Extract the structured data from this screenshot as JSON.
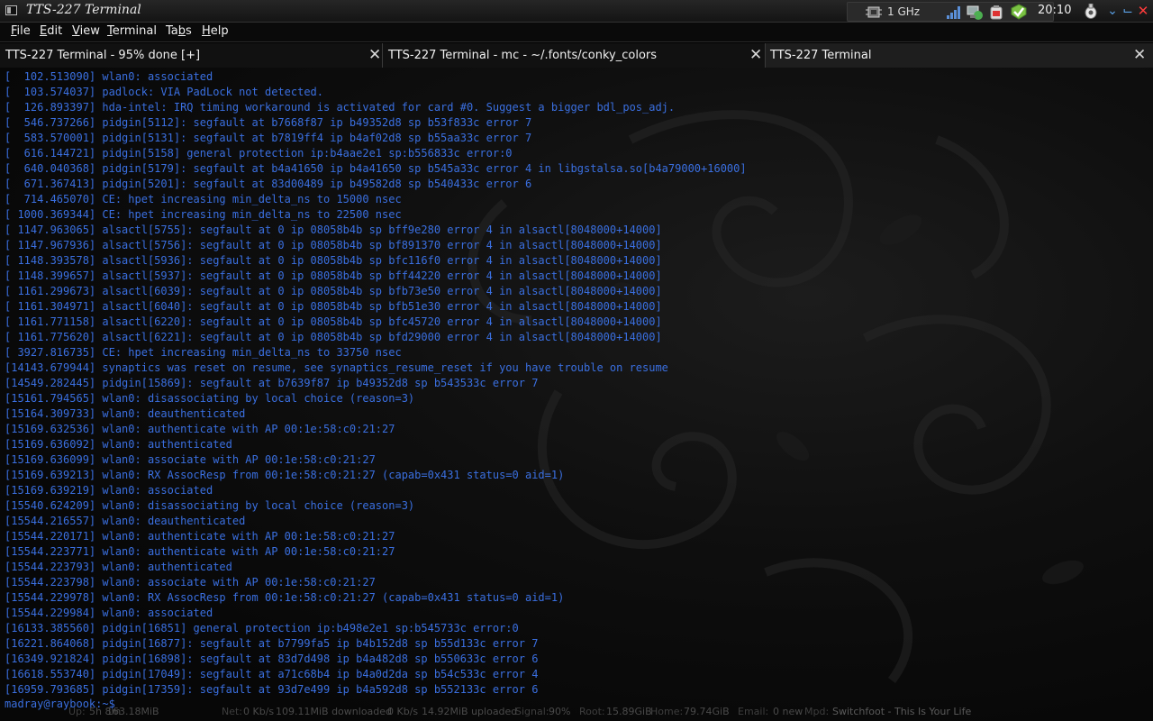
{
  "window": {
    "title": "TTS-227 Terminal",
    "clock": "20:10",
    "tray": {
      "cpu_freq": "1 GHz",
      "icons": [
        "cpu-icon",
        "signal-strength-icon",
        "network-icon",
        "battery-icon",
        "update-check-icon",
        "power-icon"
      ]
    },
    "controls": [
      "minimize",
      "maximize",
      "close"
    ]
  },
  "menu": {
    "file": "File",
    "edit": "Edit",
    "view": "View",
    "terminal": "Terminal",
    "tabs": "Tabs",
    "help": "Help"
  },
  "tabs": [
    {
      "label": "TTS-227 Terminal - 95% done [+]"
    },
    {
      "label": "TTS-227 Terminal - mc - ~/.fonts/conky_colors"
    },
    {
      "label": "TTS-227 Terminal"
    }
  ],
  "terminal": {
    "lines": [
      "[  102.513090] wlan0: associated",
      "[  103.574037] padlock: VIA PadLock not detected.",
      "[  126.893397] hda-intel: IRQ timing workaround is activated for card #0. Suggest a bigger bdl_pos_adj.",
      "[  546.737266] pidgin[5112]: segfault at b7668f87 ip b49352d8 sp b53f833c error 7",
      "[  583.570001] pidgin[5131]: segfault at b7819ff4 ip b4af02d8 sp b55aa33c error 7",
      "[  616.144721] pidgin[5158] general protection ip:b4aae2e1 sp:b556833c error:0",
      "[  640.040368] pidgin[5179]: segfault at b4a41650 ip b4a41650 sp b545a33c error 4 in libgstalsa.so[b4a79000+16000]",
      "[  671.367413] pidgin[5201]: segfault at 83d00489 ip b49582d8 sp b540433c error 6",
      "[  714.465070] CE: hpet increasing min_delta_ns to 15000 nsec",
      "[ 1000.369344] CE: hpet increasing min_delta_ns to 22500 nsec",
      "[ 1147.963065] alsactl[5755]: segfault at 0 ip 08058b4b sp bff9e280 error 4 in alsactl[8048000+14000]",
      "[ 1147.967936] alsactl[5756]: segfault at 0 ip 08058b4b sp bf891370 error 4 in alsactl[8048000+14000]",
      "[ 1148.393578] alsactl[5936]: segfault at 0 ip 08058b4b sp bfc116f0 error 4 in alsactl[8048000+14000]",
      "[ 1148.399657] alsactl[5937]: segfault at 0 ip 08058b4b sp bff44220 error 4 in alsactl[8048000+14000]",
      "[ 1161.299673] alsactl[6039]: segfault at 0 ip 08058b4b sp bfb73e50 error 4 in alsactl[8048000+14000]",
      "[ 1161.304971] alsactl[6040]: segfault at 0 ip 08058b4b sp bfb51e30 error 4 in alsactl[8048000+14000]",
      "[ 1161.771158] alsactl[6220]: segfault at 0 ip 08058b4b sp bfc45720 error 4 in alsactl[8048000+14000]",
      "[ 1161.775620] alsactl[6221]: segfault at 0 ip 08058b4b sp bfd29000 error 4 in alsactl[8048000+14000]",
      "[ 3927.816735] CE: hpet increasing min_delta_ns to 33750 nsec",
      "[14143.679944] synaptics was reset on resume, see synaptics_resume_reset if you have trouble on resume",
      "[14549.282445] pidgin[15869]: segfault at b7639f87 ip b49352d8 sp b543533c error 7",
      "[15161.794565] wlan0: disassociating by local choice (reason=3)",
      "[15164.309733] wlan0: deauthenticated",
      "[15169.632536] wlan0: authenticate with AP 00:1e:58:c0:21:27",
      "[15169.636092] wlan0: authenticated",
      "[15169.636099] wlan0: associate with AP 00:1e:58:c0:21:27",
      "[15169.639213] wlan0: RX AssocResp from 00:1e:58:c0:21:27 (capab=0x431 status=0 aid=1)",
      "[15169.639219] wlan0: associated",
      "[15540.624209] wlan0: disassociating by local choice (reason=3)",
      "[15544.216557] wlan0: deauthenticated",
      "[15544.220171] wlan0: authenticate with AP 00:1e:58:c0:21:27",
      "[15544.223771] wlan0: authenticate with AP 00:1e:58:c0:21:27",
      "[15544.223793] wlan0: authenticated",
      "[15544.223798] wlan0: associate with AP 00:1e:58:c0:21:27",
      "[15544.229978] wlan0: RX AssocResp from 00:1e:58:c0:21:27 (capab=0x431 status=0 aid=1)",
      "[15544.229984] wlan0: associated",
      "[16133.385560] pidgin[16851] general protection ip:b498e2e1 sp:b545733c error:0",
      "[16221.864068] pidgin[16877]: segfault at b7799fa5 ip b4b152d8 sp b55d133c error 7",
      "[16349.921824] pidgin[16898]: segfault at 83d7d498 ip b4a482d8 sp b550633c error 6",
      "[16618.553740] pidgin[17049]: segfault at a71c68b4 ip b4a0d2da sp b54c533c error 4",
      "[16959.793685] pidgin[17359]: segfault at 93d7e499 ip b4a592d8 sp b552133c error 6"
    ],
    "prompt": "madray@raybook:~$"
  },
  "conky": {
    "uptime_label": "Up:",
    "uptime": "5h 8m",
    "mem": "163.18MiB",
    "net_label": "Net:",
    "net_down_rate": "0 Kb/s",
    "downloaded": "109.11MiB downloaded",
    "net_up_rate": "0 Kb/s",
    "uploaded": "14.92MiB uploaded",
    "signal_label": "Signal:",
    "signal": "90%",
    "root_label": "Root:",
    "root": "15.89GiB",
    "home_label": "Home:",
    "home": "79.74GiB",
    "email_label": "Email:",
    "email": "0 new",
    "mpd_label": "Mpd:",
    "mpd": "Switchfoot - This Is Your Life"
  },
  "colors": {
    "terminal_text": "#3a6fe0",
    "close_button": "#ff3b3b",
    "window_buttons": "#5aa0e6"
  }
}
